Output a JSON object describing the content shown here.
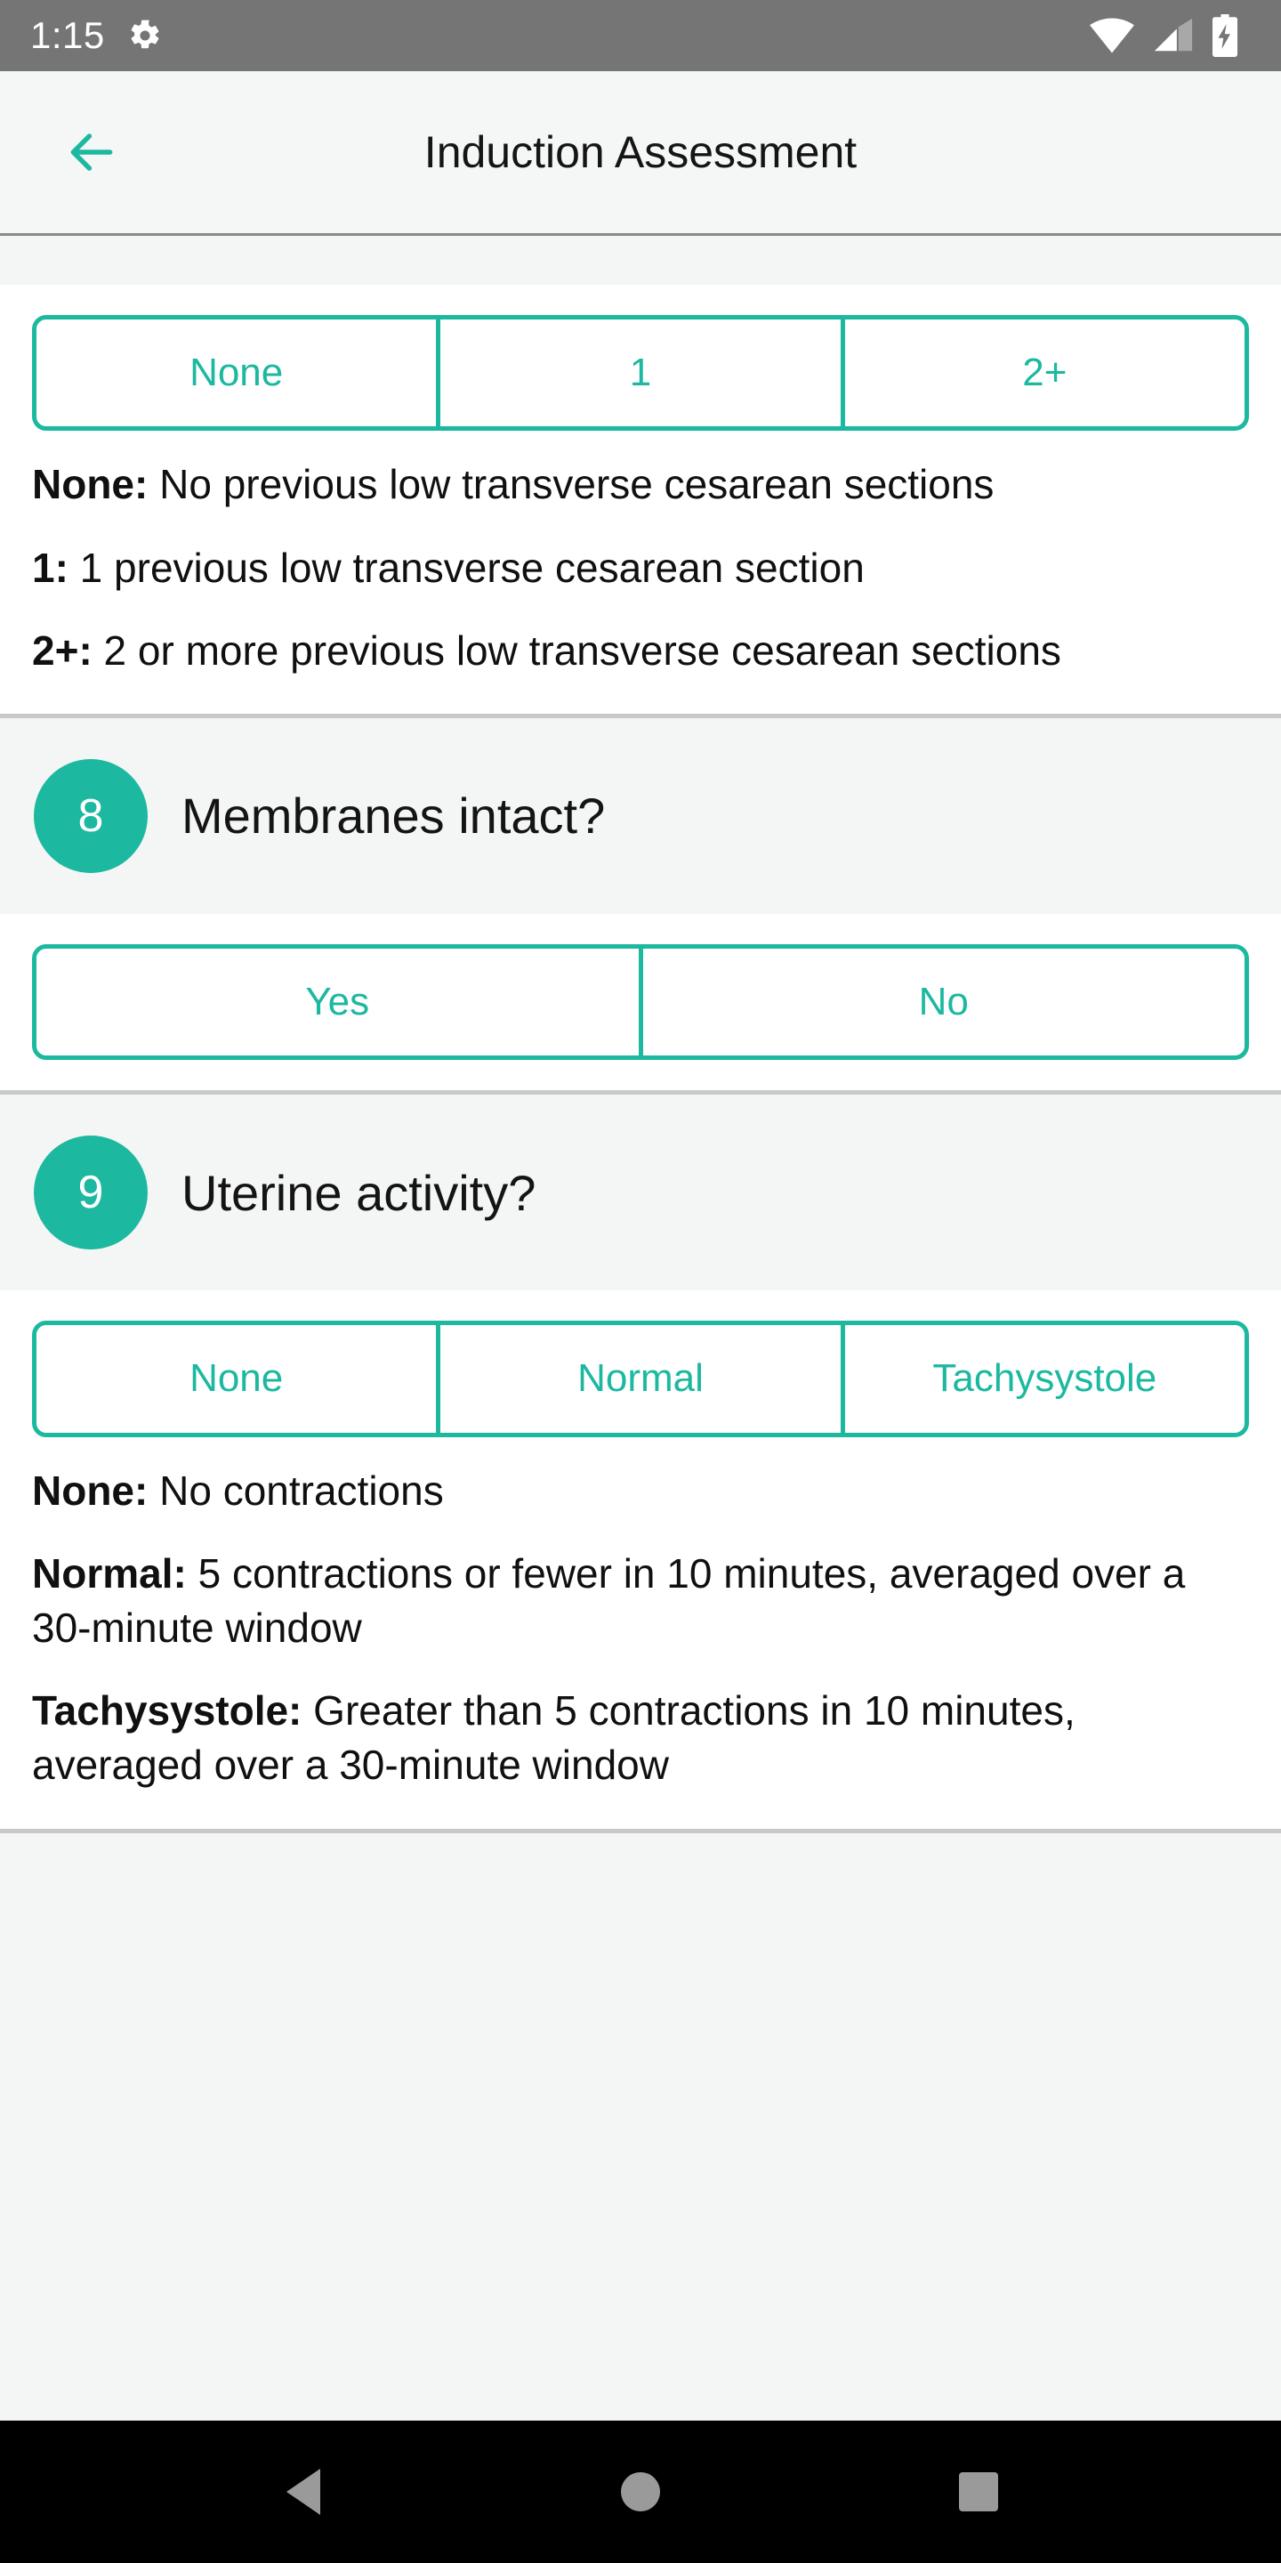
{
  "status_bar": {
    "clock": "1:15",
    "icons": [
      "gear-icon",
      "wifi-icon",
      "cellular-signal-icon",
      "battery-charging-icon"
    ],
    "background_color": "#757575"
  },
  "app_bar": {
    "back_label": "back-arrow-icon",
    "title": "Induction Assessment",
    "accent_color": "#1cb8a0"
  },
  "theme": {
    "accent": "#1cb8a0",
    "page_background": "#f4f5f5",
    "card_background": "#ffffff",
    "text": "#101010",
    "divider": "#c9c9c9"
  },
  "sections": [
    {
      "id": "previous-cesarean",
      "segments": [
        "None",
        "1",
        "2+"
      ],
      "descriptions": [
        {
          "key": "None:",
          "text": " No previous low transverse cesarean sections"
        },
        {
          "key": "1:",
          "text": " 1 previous low transverse cesarean section"
        },
        {
          "key": "2+:",
          "text": " 2 or more previous low transverse cesarean sections"
        }
      ]
    },
    {
      "id": "membranes-intact",
      "number": "8",
      "question": "Membranes intact?",
      "segments": [
        "Yes",
        "No"
      ],
      "descriptions": []
    },
    {
      "id": "uterine-activity",
      "number": "9",
      "question": "Uterine activity?",
      "segments": [
        "None",
        "Normal",
        "Tachysystole"
      ],
      "descriptions": [
        {
          "key": "None:",
          "text": " No contractions"
        },
        {
          "key": "Normal:",
          "text": " 5 contractions or fewer in 10 minutes, averaged over a 30-minute window"
        },
        {
          "key": "Tachysystole:",
          "text": " Greater than 5 contractions in 10 minutes, averaged over a 30-minute window"
        }
      ]
    }
  ],
  "nav_bar": {
    "back": "nav-back-icon",
    "home": "nav-home-icon",
    "recents": "nav-recent-icon",
    "background_color": "#000000"
  }
}
